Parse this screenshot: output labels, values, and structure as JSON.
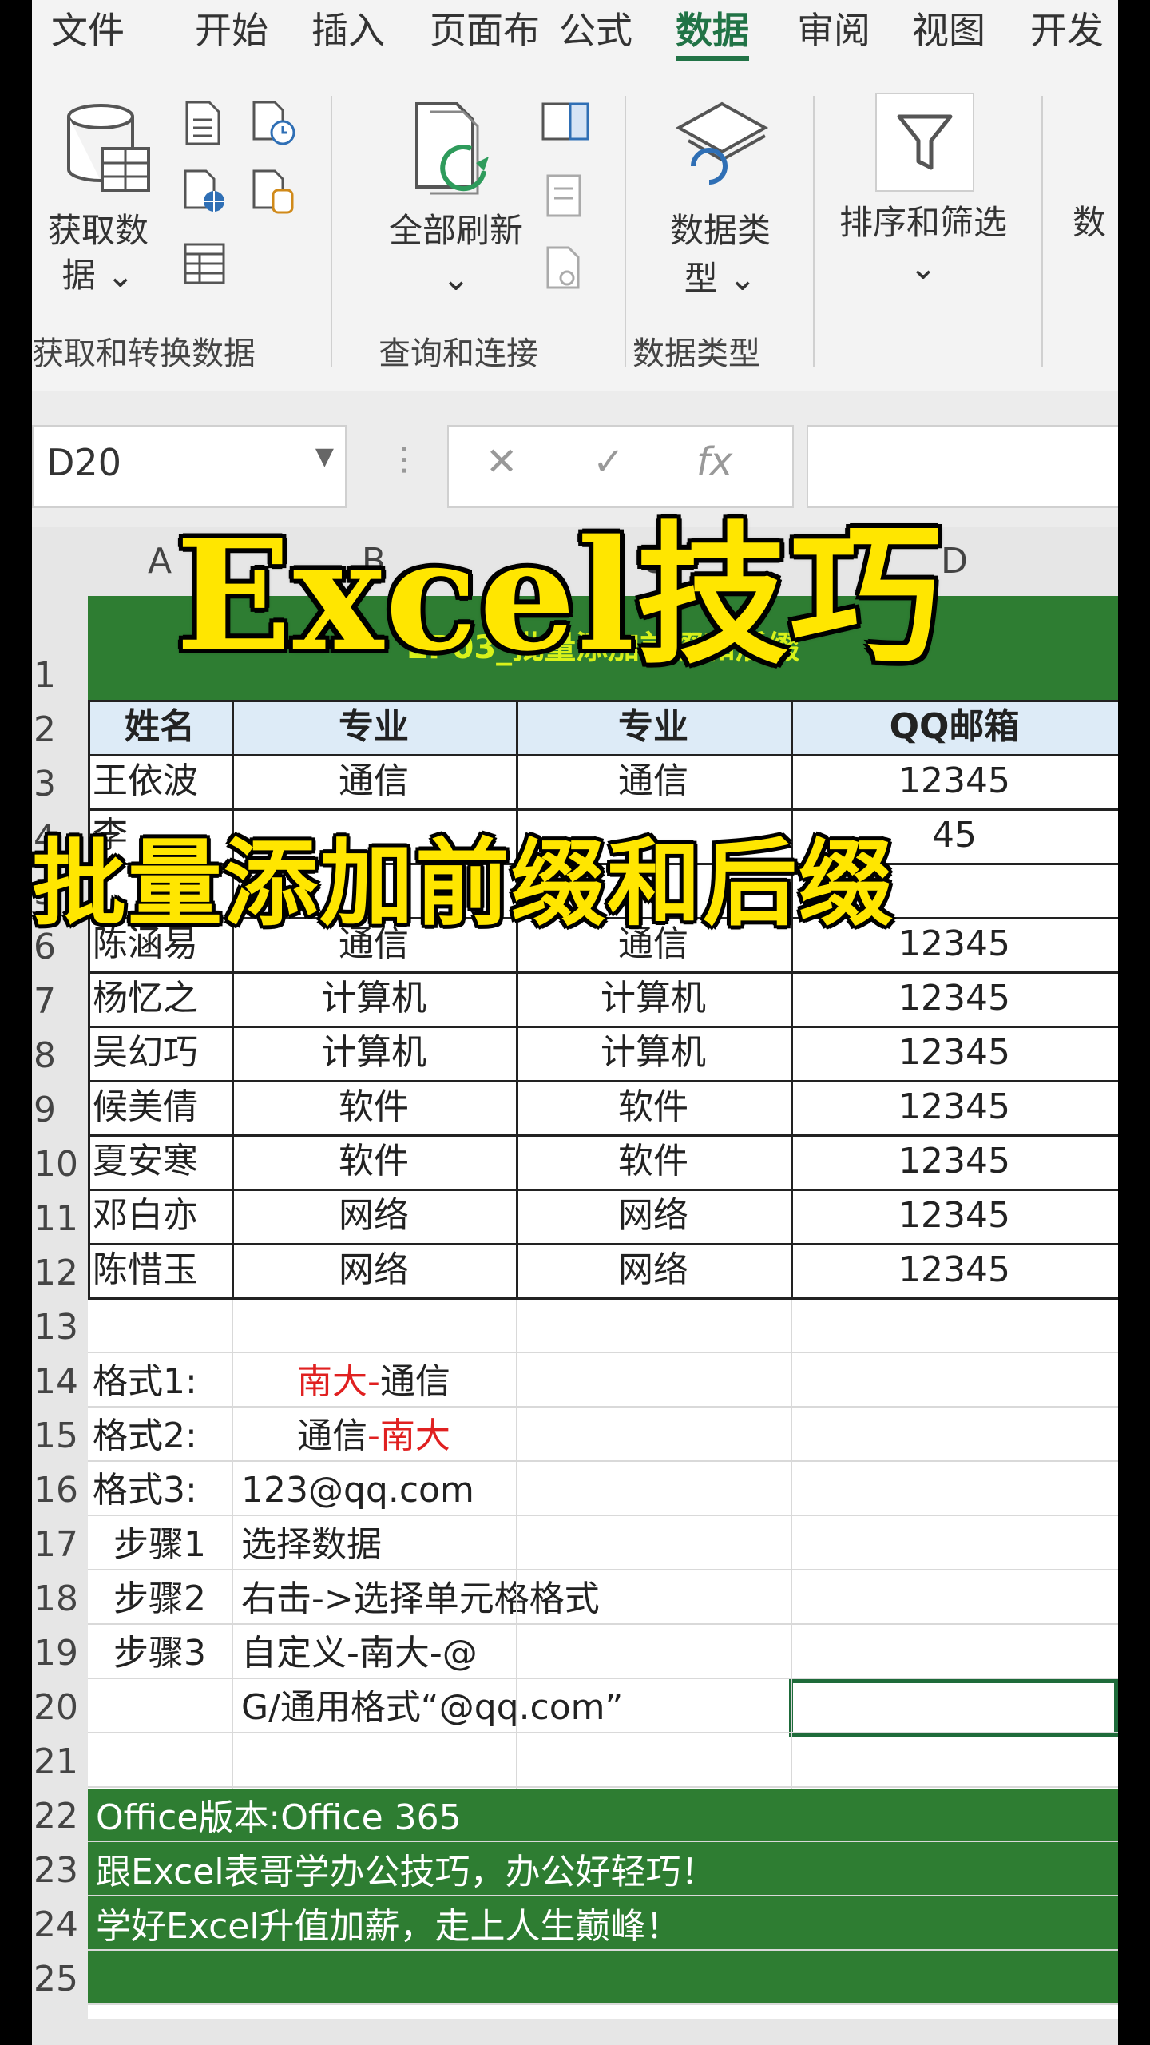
{
  "ribbon": {
    "tabs": [
      {
        "label": "文件"
      },
      {
        "label": "开始"
      },
      {
        "label": "插入"
      },
      {
        "label": "页面布"
      },
      {
        "label": "公式"
      },
      {
        "label": "数据"
      },
      {
        "label": "审阅"
      },
      {
        "label": "视图"
      },
      {
        "label": "开发"
      }
    ],
    "get_data_l1": "获取数",
    "get_data_l2": "据 ⌄",
    "refresh_all": "全部刷新",
    "refresh_arrow": "⌄",
    "data_types_l1": "数据类",
    "data_types_l2": "型 ⌄",
    "sort_filter": "排序和筛选",
    "sort_filter_arrow": "⌄",
    "partial_label": "数",
    "groups": {
      "get_transform": "获取和转换数据",
      "queries": "查询和连接",
      "data_types": "数据类型"
    }
  },
  "formula_bar": {
    "name_box": "D20",
    "cancel": "✕",
    "enter": "✓",
    "fx": "fx"
  },
  "columns": [
    "A",
    "B",
    "C",
    "D"
  ],
  "rows": [
    "1",
    "2",
    "3",
    "4",
    "5",
    "6",
    "7",
    "8",
    "9",
    "10",
    "11",
    "12",
    "13",
    "14",
    "15",
    "16",
    "17",
    "18",
    "19",
    "20",
    "21",
    "22",
    "23",
    "24",
    "25"
  ],
  "sheet": {
    "title_banner": "EP03_批量添加前缀和后缀",
    "headers": [
      "姓名",
      "专业",
      "专业",
      "QQ邮箱"
    ],
    "data_rows": [
      {
        "name": "王依波",
        "major": "通信",
        "major2": "通信",
        "qq": "12345"
      },
      {
        "name": "李",
        "major": "",
        "major2": "",
        "qq": "45"
      },
      {
        "name": "",
        "major": "",
        "major2": "",
        "qq": ""
      },
      {
        "name": "陈涵易",
        "major": "通信",
        "major2": "通信",
        "qq": "12345"
      },
      {
        "name": "杨忆之",
        "major": "计算机",
        "major2": "计算机",
        "qq": "12345"
      },
      {
        "name": "吴幻巧",
        "major": "计算机",
        "major2": "计算机",
        "qq": "12345"
      },
      {
        "name": "候美倩",
        "major": "软件",
        "major2": "软件",
        "qq": "12345"
      },
      {
        "name": "夏安寒",
        "major": "软件",
        "major2": "软件",
        "qq": "12345"
      },
      {
        "name": "邓白亦",
        "major": "网络",
        "major2": "网络",
        "qq": "12345"
      },
      {
        "name": "陈惜玉",
        "major": "网络",
        "major2": "网络",
        "qq": "12345"
      }
    ],
    "format1_label": "格式1:",
    "format1_prefix": "南大-",
    "format1_value": "通信",
    "format2_label": "格式2:",
    "format2_value": "通信",
    "format2_suffix": "-南大",
    "format3_label": "格式3:",
    "format3_value": "123@qq.com",
    "steps": [
      {
        "label": "步骤1",
        "text": "选择数据"
      },
      {
        "label": "步骤2",
        "text": "右击->选择单元格格式"
      },
      {
        "label": "步骤3",
        "text": "自定义-南大-@"
      }
    ],
    "row20_text": "G/通用格式“@qq.com”",
    "footer": [
      "Office版本:Office 365",
      "跟Excel表哥学办公技巧，办公好轻巧！",
      "学好Excel升值加薪，走上人生巅峰！"
    ]
  },
  "overlay": {
    "title": "Excel技巧",
    "subtitle": "批量添加前缀和后缀"
  },
  "colors": {
    "excel_green": "#217346",
    "banner_green": "#2e7d32",
    "header_blue": "#ddebf7",
    "red_text": "#e02020",
    "overlay_yellow": "#ffe600"
  }
}
